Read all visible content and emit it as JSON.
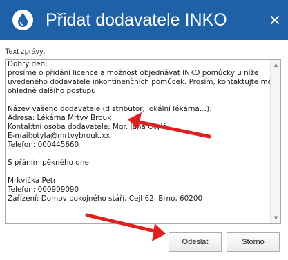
{
  "dialog": {
    "title": "Přidat dodavatele INKO",
    "app_icon": "water-drop-icon",
    "close_icon": "close-icon"
  },
  "message": {
    "label": "Text zprávy:",
    "body": "Dobrý den,\nprosíme o přidání licence a možnost objednávat INKO pomůcky u níže\nuvedeného dodavatele inkontinenčních pomůcek. Prosím, kontaktujte mě\nohledně dalšího postupu.\n\nNázev vašeho dodavatele (distributor, lokální lékárna…):\nAdresa: Lékárna Mrtvý Brouk\nKontaktní osoba dodavatele: Mgr. Jana Otylá\nE-mail:otyla@mrtvybrouk.xx\nTelefon: 000445660\n\nS přáním pěkného dne\n\nMrkvička Petr\nTelefon: 000909090\nZařízení: Domov pokojného stáří, Cejl 62, Brno, 60200"
  },
  "buttons": {
    "submit_label": "Odeslat",
    "cancel_label": "Storno"
  },
  "colors": {
    "titlebar": "#1e61a6",
    "annotation_arrow": "#e02020"
  },
  "annotations": [
    {
      "name": "arrow-to-email",
      "icon": "red-arrow"
    },
    {
      "name": "arrow-to-submit",
      "icon": "red-arrow"
    }
  ]
}
